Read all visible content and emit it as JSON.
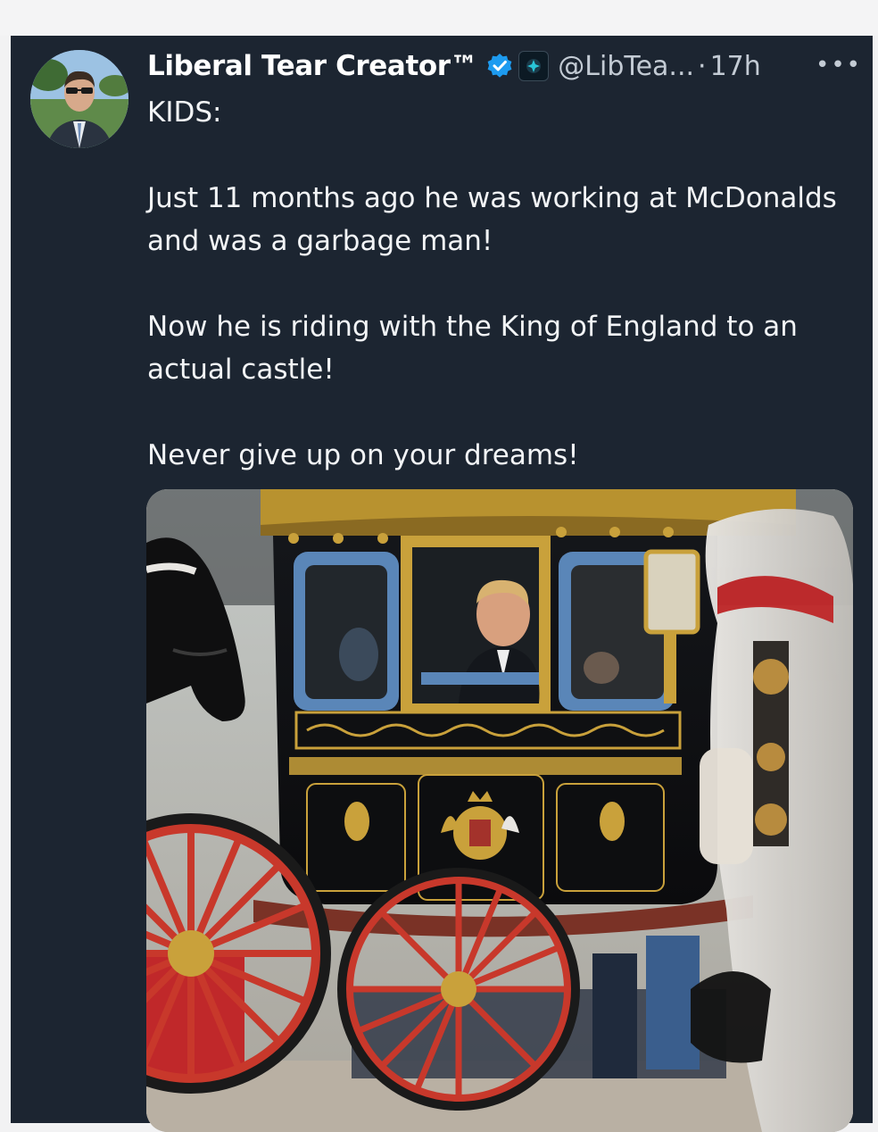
{
  "tweet": {
    "author_name": "Liberal Tear Creator™",
    "handle": "@LibTea...",
    "separator": "·",
    "time": "17h",
    "more_label": "•••",
    "text": "KIDS:\n\nJust 11 months ago he was working at McDonalds and was a garbage man!\n\nNow he is riding with the King of England to an actual castle!\n\nNever give up on your dreams!",
    "icons": {
      "verified": "verified-badge-icon",
      "affiliation": "affiliate-badge-icon",
      "more": "more-options-icon"
    }
  },
  "colors": {
    "card_background": "#1c2531",
    "text": "#f2f4f6",
    "secondary_text": "#c3cbd4",
    "verified_blue": "#1d9bf0",
    "carriage_red": "#c8382b",
    "gold": "#c9a13b"
  }
}
